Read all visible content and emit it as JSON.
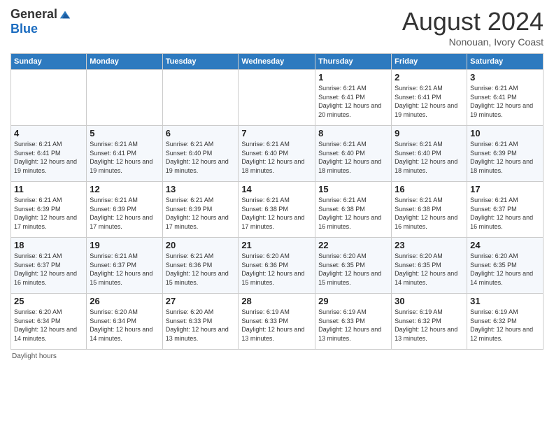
{
  "header": {
    "logo_general": "General",
    "logo_blue": "Blue",
    "month_title": "August 2024",
    "subtitle": "Nonouan, Ivory Coast"
  },
  "days_of_week": [
    "Sunday",
    "Monday",
    "Tuesday",
    "Wednesday",
    "Thursday",
    "Friday",
    "Saturday"
  ],
  "footer_note": "Daylight hours",
  "weeks": [
    [
      {
        "day": "",
        "info": ""
      },
      {
        "day": "",
        "info": ""
      },
      {
        "day": "",
        "info": ""
      },
      {
        "day": "",
        "info": ""
      },
      {
        "day": "1",
        "info": "Sunrise: 6:21 AM\nSunset: 6:41 PM\nDaylight: 12 hours and 20 minutes."
      },
      {
        "day": "2",
        "info": "Sunrise: 6:21 AM\nSunset: 6:41 PM\nDaylight: 12 hours and 19 minutes."
      },
      {
        "day": "3",
        "info": "Sunrise: 6:21 AM\nSunset: 6:41 PM\nDaylight: 12 hours and 19 minutes."
      }
    ],
    [
      {
        "day": "4",
        "info": "Sunrise: 6:21 AM\nSunset: 6:41 PM\nDaylight: 12 hours and 19 minutes."
      },
      {
        "day": "5",
        "info": "Sunrise: 6:21 AM\nSunset: 6:41 PM\nDaylight: 12 hours and 19 minutes."
      },
      {
        "day": "6",
        "info": "Sunrise: 6:21 AM\nSunset: 6:40 PM\nDaylight: 12 hours and 19 minutes."
      },
      {
        "day": "7",
        "info": "Sunrise: 6:21 AM\nSunset: 6:40 PM\nDaylight: 12 hours and 18 minutes."
      },
      {
        "day": "8",
        "info": "Sunrise: 6:21 AM\nSunset: 6:40 PM\nDaylight: 12 hours and 18 minutes."
      },
      {
        "day": "9",
        "info": "Sunrise: 6:21 AM\nSunset: 6:40 PM\nDaylight: 12 hours and 18 minutes."
      },
      {
        "day": "10",
        "info": "Sunrise: 6:21 AM\nSunset: 6:39 PM\nDaylight: 12 hours and 18 minutes."
      }
    ],
    [
      {
        "day": "11",
        "info": "Sunrise: 6:21 AM\nSunset: 6:39 PM\nDaylight: 12 hours and 17 minutes."
      },
      {
        "day": "12",
        "info": "Sunrise: 6:21 AM\nSunset: 6:39 PM\nDaylight: 12 hours and 17 minutes."
      },
      {
        "day": "13",
        "info": "Sunrise: 6:21 AM\nSunset: 6:39 PM\nDaylight: 12 hours and 17 minutes."
      },
      {
        "day": "14",
        "info": "Sunrise: 6:21 AM\nSunset: 6:38 PM\nDaylight: 12 hours and 17 minutes."
      },
      {
        "day": "15",
        "info": "Sunrise: 6:21 AM\nSunset: 6:38 PM\nDaylight: 12 hours and 16 minutes."
      },
      {
        "day": "16",
        "info": "Sunrise: 6:21 AM\nSunset: 6:38 PM\nDaylight: 12 hours and 16 minutes."
      },
      {
        "day": "17",
        "info": "Sunrise: 6:21 AM\nSunset: 6:37 PM\nDaylight: 12 hours and 16 minutes."
      }
    ],
    [
      {
        "day": "18",
        "info": "Sunrise: 6:21 AM\nSunset: 6:37 PM\nDaylight: 12 hours and 16 minutes."
      },
      {
        "day": "19",
        "info": "Sunrise: 6:21 AM\nSunset: 6:37 PM\nDaylight: 12 hours and 15 minutes."
      },
      {
        "day": "20",
        "info": "Sunrise: 6:21 AM\nSunset: 6:36 PM\nDaylight: 12 hours and 15 minutes."
      },
      {
        "day": "21",
        "info": "Sunrise: 6:20 AM\nSunset: 6:36 PM\nDaylight: 12 hours and 15 minutes."
      },
      {
        "day": "22",
        "info": "Sunrise: 6:20 AM\nSunset: 6:35 PM\nDaylight: 12 hours and 15 minutes."
      },
      {
        "day": "23",
        "info": "Sunrise: 6:20 AM\nSunset: 6:35 PM\nDaylight: 12 hours and 14 minutes."
      },
      {
        "day": "24",
        "info": "Sunrise: 6:20 AM\nSunset: 6:35 PM\nDaylight: 12 hours and 14 minutes."
      }
    ],
    [
      {
        "day": "25",
        "info": "Sunrise: 6:20 AM\nSunset: 6:34 PM\nDaylight: 12 hours and 14 minutes."
      },
      {
        "day": "26",
        "info": "Sunrise: 6:20 AM\nSunset: 6:34 PM\nDaylight: 12 hours and 14 minutes."
      },
      {
        "day": "27",
        "info": "Sunrise: 6:20 AM\nSunset: 6:33 PM\nDaylight: 12 hours and 13 minutes."
      },
      {
        "day": "28",
        "info": "Sunrise: 6:19 AM\nSunset: 6:33 PM\nDaylight: 12 hours and 13 minutes."
      },
      {
        "day": "29",
        "info": "Sunrise: 6:19 AM\nSunset: 6:33 PM\nDaylight: 12 hours and 13 minutes."
      },
      {
        "day": "30",
        "info": "Sunrise: 6:19 AM\nSunset: 6:32 PM\nDaylight: 12 hours and 13 minutes."
      },
      {
        "day": "31",
        "info": "Sunrise: 6:19 AM\nSunset: 6:32 PM\nDaylight: 12 hours and 12 minutes."
      }
    ]
  ]
}
